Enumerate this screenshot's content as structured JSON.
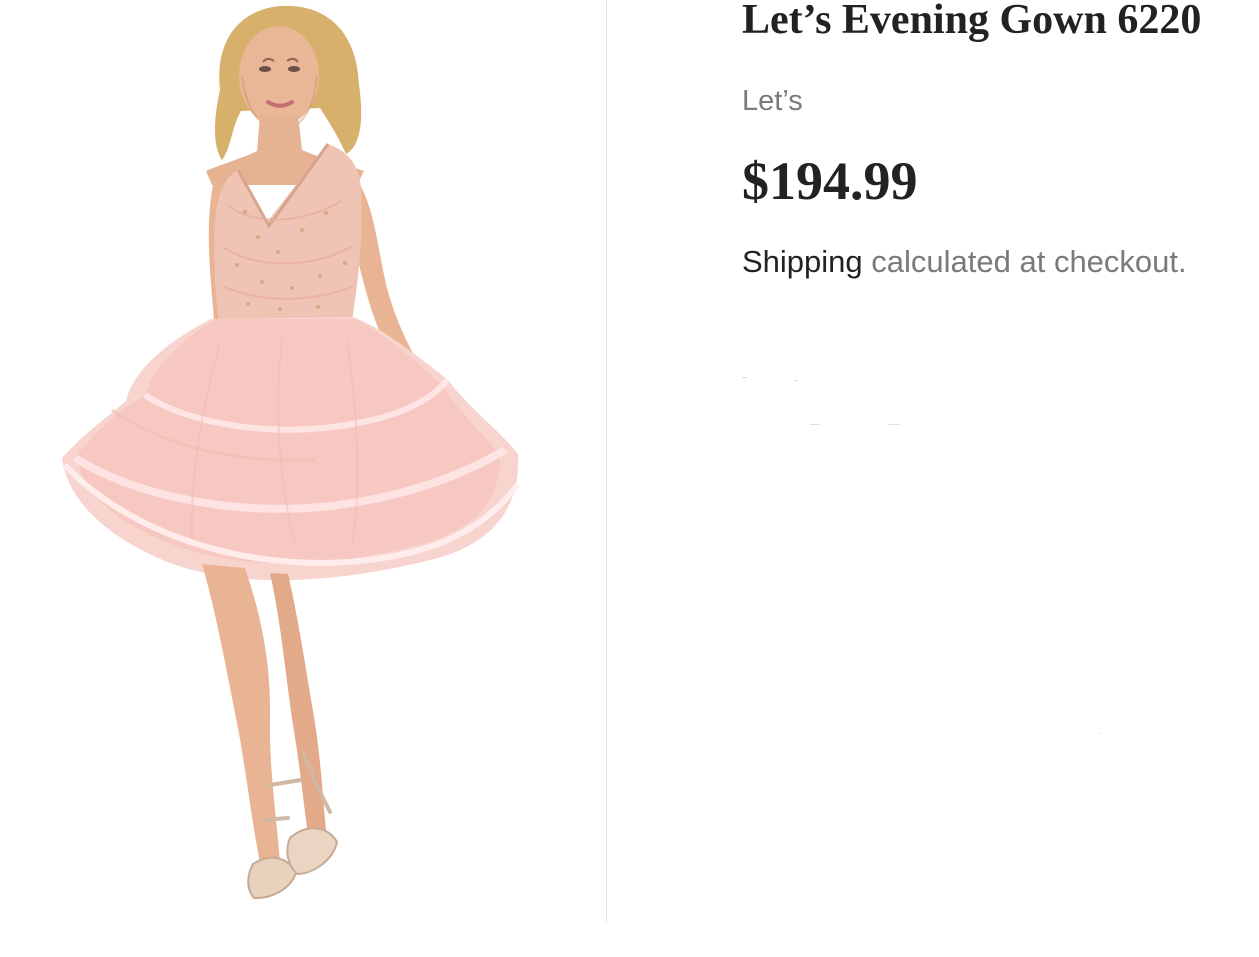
{
  "product": {
    "title": "Let’s Evening Gown 6220",
    "vendor": "Let’s",
    "price": "$194.99",
    "shipping_link_text": "Shipping",
    "shipping_rest_text": " calculated at checkout."
  },
  "colors": {
    "title": "#222222",
    "muted": "#7a7a7a",
    "dress": "#f7c8c2",
    "bodice": "#efc4b4",
    "skin": "#e9b796",
    "hair": "#d7b06c"
  }
}
